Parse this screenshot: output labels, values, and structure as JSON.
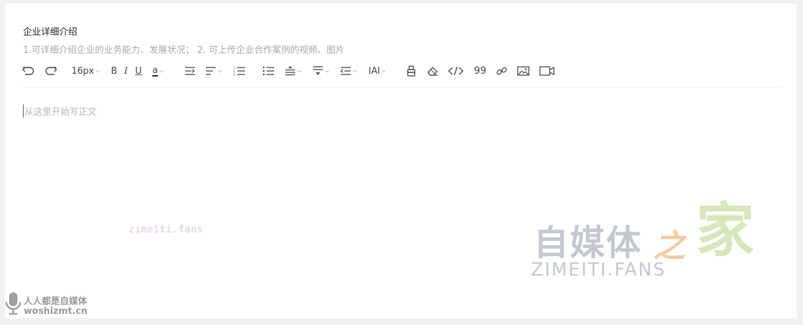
{
  "section": {
    "title": "企业详细介绍",
    "hint": "1.可详细介绍企业的业务能力、发展状况； 2. 可上传企业合作案例的视频、图片"
  },
  "toolbar": {
    "font_size": "16px",
    "bold": "B",
    "italic": "I",
    "underline": "U",
    "font_color": "a",
    "letter_spacing": "IAI",
    "blockquote": "99"
  },
  "editor": {
    "placeholder": "从这里开始写正文"
  },
  "watermarks": {
    "small": "zimeiti.fans",
    "big_cn": "自媒体",
    "big_zhi": "之",
    "big_jia": "家",
    "big_en": "ZIMEITI.FANS",
    "corner_cn": "人人都是自媒体",
    "corner_en": "woshizmt.cn"
  },
  "colors": {
    "text": "#222222",
    "hint": "#a8a8a8",
    "placeholder": "#b5b5b5",
    "icon": "#444444"
  }
}
